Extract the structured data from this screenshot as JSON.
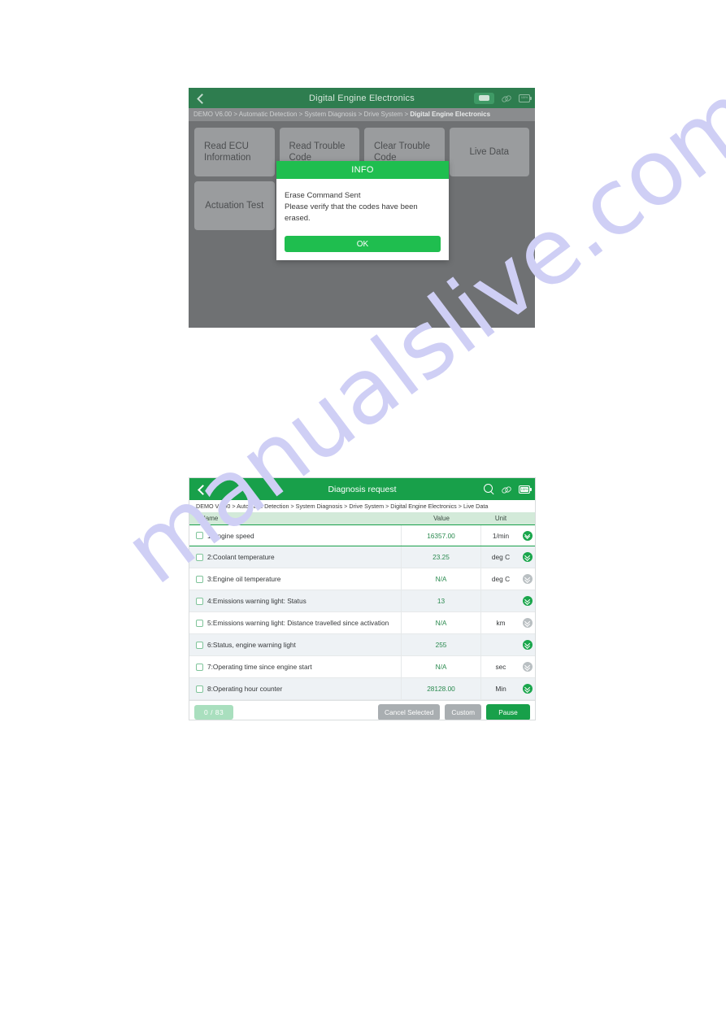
{
  "watermark": {
    "text": "manualslive.com"
  },
  "screenshot_clear_codes": {
    "header": {
      "title": "Digital Engine Electronics",
      "back_icon": "back-chevron-icon",
      "chat_icon": "chat-badge-icon",
      "link_icon": "link-icon",
      "battery_icon": "battery-icon",
      "battery_pct": "100%"
    },
    "breadcrumb": {
      "prefix": "DEMO V6.00 > Automatic Detection > System Diagnosis > Drive System > ",
      "current": "Digital Engine Electronics"
    },
    "menu_tiles": [
      {
        "label": "Read ECU Information",
        "align": "left"
      },
      {
        "label": "Read Trouble Code",
        "align": "left"
      },
      {
        "label": "Clear Trouble Code",
        "align": "left"
      },
      {
        "label": "Live Data",
        "align": "center"
      },
      {
        "label": "Actuation Test",
        "align": "center"
      }
    ],
    "dialog": {
      "title": "INFO",
      "line1": "Erase Command Sent",
      "line2": "Please verify that the codes have been erased.",
      "ok_label": "OK"
    }
  },
  "screenshot_live_data": {
    "header": {
      "title": "Diagnosis request",
      "back_icon": "back-chevron-icon",
      "search_icon": "search-icon",
      "link_icon": "link-icon",
      "battery_icon": "battery-icon",
      "battery_pct": "100%"
    },
    "breadcrumb": "DEMO V6.00 > Automatic Detection  > System Diagnosis  > Drive System  > Digital Engine Electronics  > Live Data",
    "columns": {
      "name": "Name",
      "value": "Value",
      "unit": "Unit"
    },
    "rows": [
      {
        "name": "1:Engine speed",
        "value": "16357.00",
        "unit": "1/min",
        "active": true
      },
      {
        "name": "2:Coolant temperature",
        "value": "23.25",
        "unit": "deg C",
        "active": true
      },
      {
        "name": "3:Engine oil temperature",
        "value": "N/A",
        "unit": "deg C",
        "active": false
      },
      {
        "name": "4:Emissions warning light: Status",
        "value": "13",
        "unit": "",
        "active": true
      },
      {
        "name": "5:Emissions warning light: Distance travelled since activation",
        "value": "N/A",
        "unit": "km",
        "active": false
      },
      {
        "name": "6:Status, engine warning light",
        "value": "255",
        "unit": "",
        "active": true
      },
      {
        "name": "7:Operating time since engine start",
        "value": "N/A",
        "unit": "sec",
        "active": false
      },
      {
        "name": "8:Operating hour counter",
        "value": "28128.00",
        "unit": "Min",
        "active": true
      }
    ],
    "footer": {
      "count": "0 / 83",
      "cancel_selected": "Cancel Selected",
      "custom": "Custom",
      "pause": "Pause"
    }
  },
  "colors": {
    "brand_green": "#18a04a",
    "dialog_green": "#1fbe4f",
    "dimmed_green": "#2e7d4f",
    "overlay_grey": "#6f7173",
    "tile_grey": "#9a9c9e",
    "row_alt": "#eef2f5",
    "value_green": "#2a8a4f",
    "watermark": "#cfcff5"
  }
}
